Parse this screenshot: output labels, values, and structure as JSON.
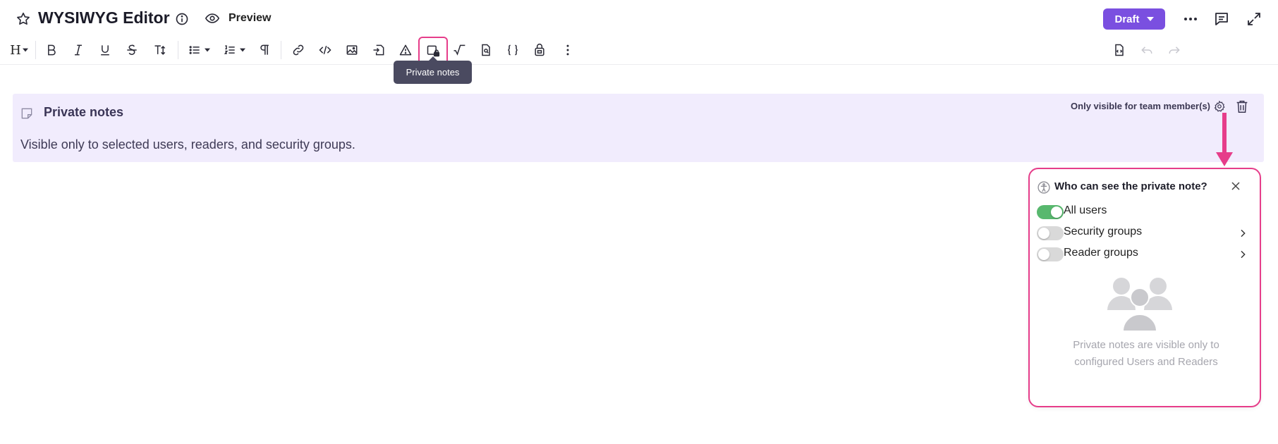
{
  "header": {
    "title": "WYSIWYG Editor",
    "preview_label": "Preview",
    "draft_label": "Draft"
  },
  "toolbar": {
    "heading_label": "H",
    "tooltip": "Private notes"
  },
  "note": {
    "title": "Private notes",
    "text": "Visible only to selected users, readers, and security groups.",
    "visibility_label": "Only visible for team member(s)"
  },
  "popover": {
    "title": "Who can see the private note?",
    "options": [
      {
        "label": "All users",
        "enabled": true
      },
      {
        "label": "Security groups",
        "enabled": false
      },
      {
        "label": "Reader groups",
        "enabled": false
      }
    ],
    "empty_text_line1": "Private notes are visible only to",
    "empty_text_line2": "configured Users and Readers"
  },
  "colors": {
    "accent": "#7a4fe0",
    "highlight": "#e63d8a",
    "note_bg": "#f1ecfd",
    "toggle_on": "#58b86e"
  }
}
